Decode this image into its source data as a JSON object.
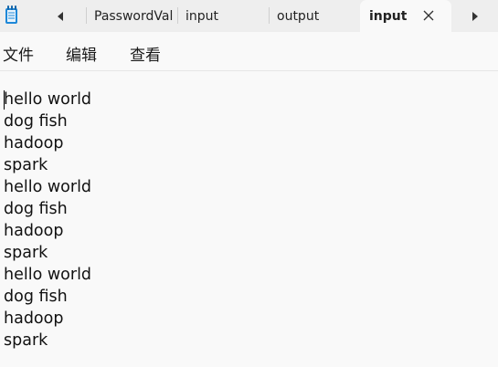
{
  "tabs": {
    "items": [
      {
        "label": "PasswordVal"
      },
      {
        "label": "input"
      },
      {
        "label": "output"
      },
      {
        "label": "input",
        "active": true
      }
    ]
  },
  "menu": {
    "file": "文件",
    "edit": "编辑",
    "view": "查看"
  },
  "editor": {
    "lines": [
      "hello world",
      "dog fish",
      "hadoop",
      "spark",
      "hello world",
      "dog fish",
      "hadoop",
      "spark",
      "hello world",
      "dog fish",
      "hadoop",
      "spark"
    ]
  },
  "icons": {
    "app": "notepad-icon",
    "scroll_left": "caret-left-icon",
    "scroll_right": "caret-right-icon",
    "close": "close-icon"
  },
  "colors": {
    "tabbar_bg": "#eeeeee",
    "window_bg": "#f9f9f9",
    "app_icon": "#1e88d8"
  }
}
